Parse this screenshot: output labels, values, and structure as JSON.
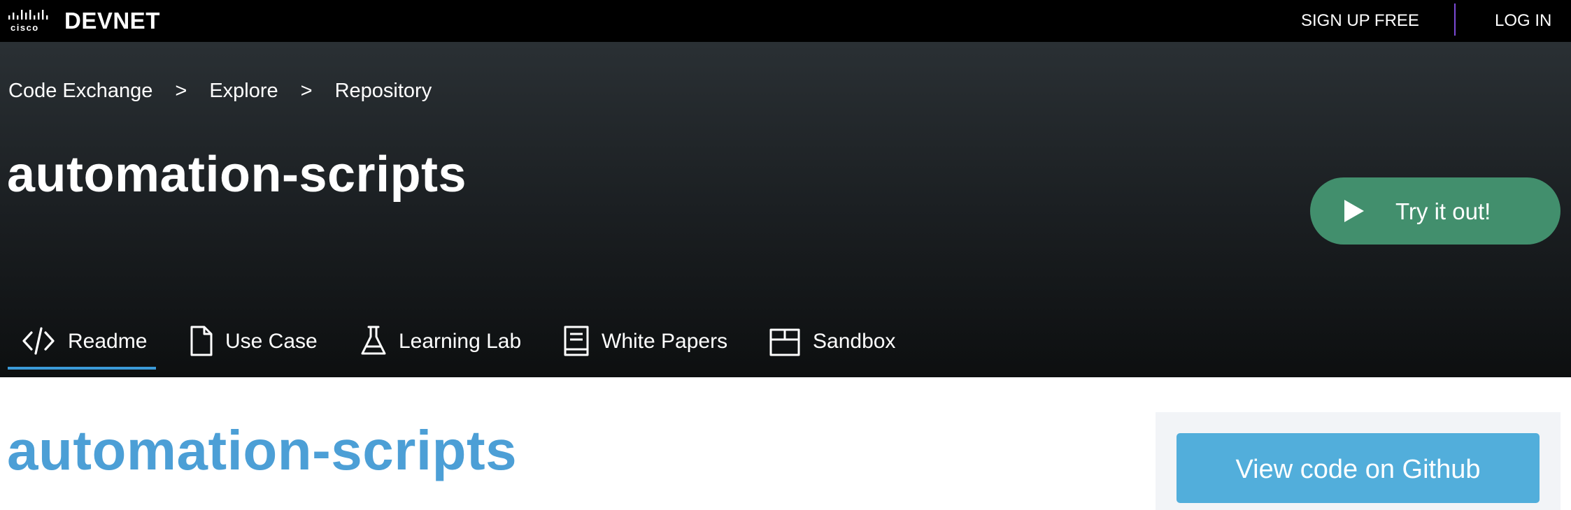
{
  "topbar": {
    "brand_small": "cisco",
    "brand": "DEVNET",
    "signup_label": "SIGN UP FREE",
    "login_label": "LOG IN"
  },
  "breadcrumb": {
    "items": [
      "Code Exchange",
      "Explore",
      "Repository"
    ],
    "separator": ">"
  },
  "hero": {
    "title": "automation-scripts",
    "try_label": "Try it out!"
  },
  "tabs": [
    {
      "label": "Readme",
      "icon": "code-icon",
      "active": true
    },
    {
      "label": "Use Case",
      "icon": "document-icon",
      "active": false
    },
    {
      "label": "Learning Lab",
      "icon": "flask-icon",
      "active": false
    },
    {
      "label": "White Papers",
      "icon": "book-icon",
      "active": false
    },
    {
      "label": "Sandbox",
      "icon": "box-icon",
      "active": false
    }
  ],
  "content": {
    "title": "automation-scripts",
    "github_label": "View code on Github"
  },
  "colors": {
    "accent_green": "#428f6d",
    "accent_blue": "#52aedb",
    "title_blue": "#4c9fd6",
    "tab_underline": "#3b9ad8",
    "divider_purple": "#7b4ad6"
  }
}
